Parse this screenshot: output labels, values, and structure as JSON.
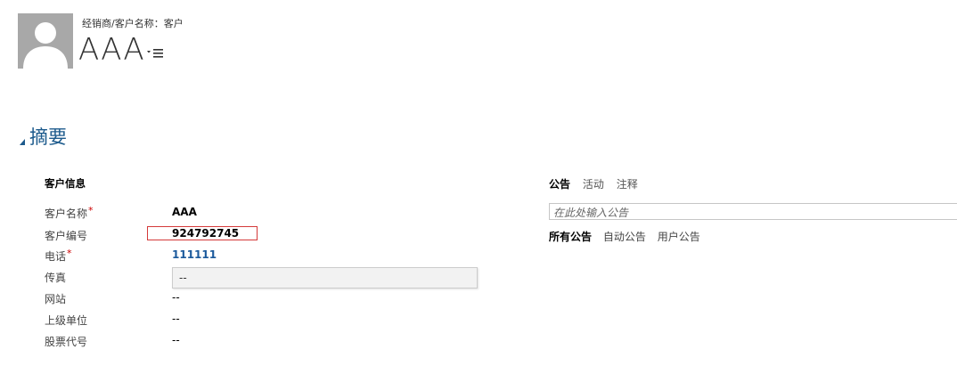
{
  "header": {
    "breadcrumb": "经销商/客户名称：客户",
    "record_title": "AAA"
  },
  "section": {
    "title": "摘要"
  },
  "customer_info": {
    "group_title": "客户信息",
    "fields": [
      {
        "label": "客户名称",
        "required": "*",
        "value": "AAA"
      },
      {
        "label": "客户编号",
        "value": "924792745"
      },
      {
        "label": "电话",
        "required": "*",
        "value": "111111"
      },
      {
        "label": "传真",
        "value": "--"
      },
      {
        "label": "网站",
        "value": "--"
      },
      {
        "label": "上级单位",
        "value": "--"
      },
      {
        "label": "股票代号",
        "value": "--"
      }
    ]
  },
  "social": {
    "tabs": [
      "公告",
      "活动",
      "注释"
    ],
    "post_placeholder": "在此处输入公告",
    "filters": [
      "所有公告",
      "自动公告",
      "用户公告"
    ]
  },
  "colors": {
    "section_title": "#1c5a8c",
    "link": "#1c5a9c",
    "required": "#cc0000",
    "highlight_border": "#d43a3a"
  }
}
